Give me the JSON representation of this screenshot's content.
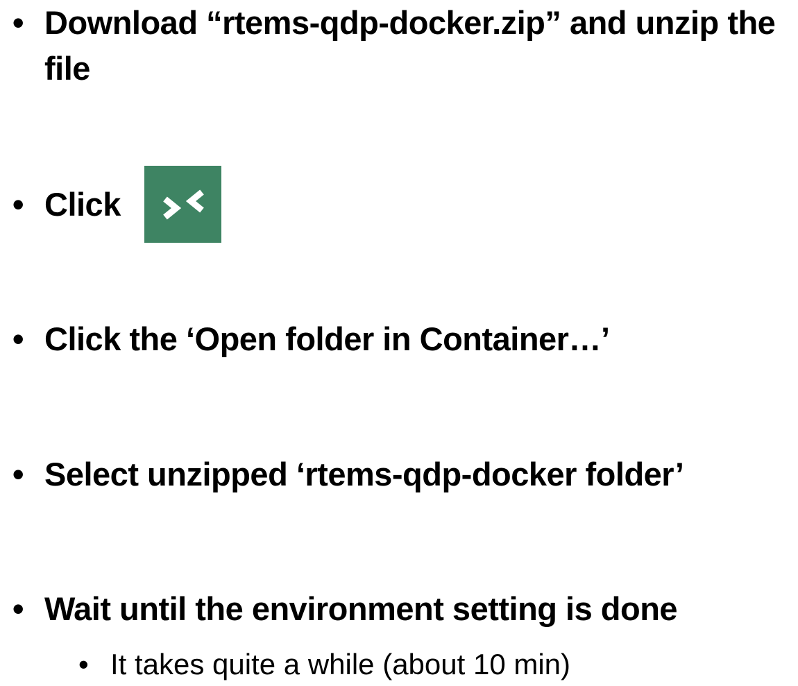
{
  "bullets": {
    "marker": "•",
    "sub_marker": "•",
    "item1": "Download “rtems-qdp-docker.zip” and unzip the file",
    "item2": "Click",
    "item2_icon": "remote-window-icon",
    "item2_icon_color": "#3e8463",
    "item3": "Click the ‘Open folder in Container…’",
    "item4": "Select unzipped ‘rtems-qdp-docker folder’",
    "item5": "Wait until the environment setting is done",
    "item5_sub": "It takes quite a while (about 10 min)"
  }
}
